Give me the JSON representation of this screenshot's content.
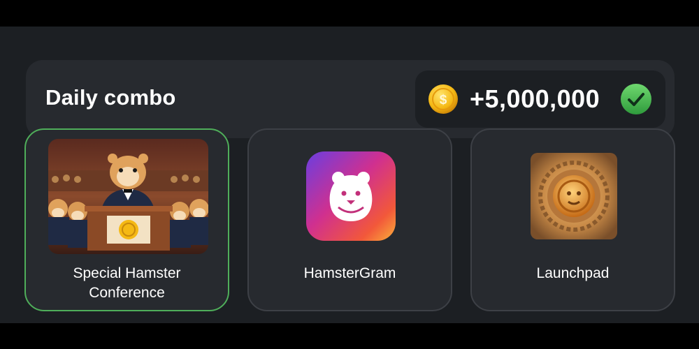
{
  "combo": {
    "title": "Daily combo",
    "reward_amount": "+5,000,000",
    "reward_icon": "coin-icon",
    "status_icon": "check-icon",
    "status": "completed"
  },
  "cards": [
    {
      "label_line1": "Special Hamster",
      "label_line2": "Conference",
      "icon": "hamster-conference-image",
      "selected": true
    },
    {
      "label_line1": "HamsterGram",
      "label_line2": "",
      "icon": "hamstergram-app-icon",
      "selected": false
    },
    {
      "label_line1": "Launchpad",
      "label_line2": "",
      "icon": "launchpad-coin-image",
      "selected": false
    }
  ],
  "colors": {
    "background": "#1c1f23",
    "surface": "#272a2f",
    "selected_border": "#4fae5a",
    "coin": "#f5b914",
    "check": "#3fb24a"
  }
}
